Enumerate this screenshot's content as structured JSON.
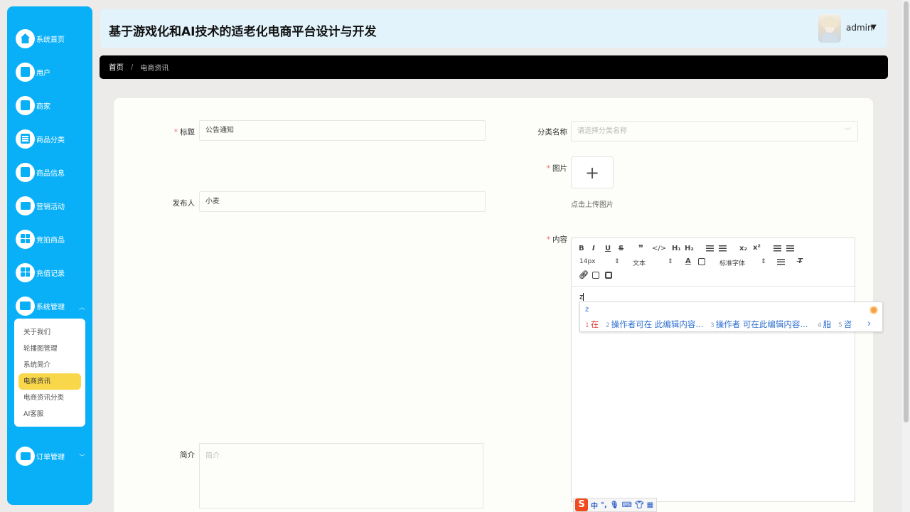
{
  "app_title": "基于游戏化和AI技术的适老化电商平台设计与开发",
  "user": {
    "name": "admin"
  },
  "sidebar": {
    "items": [
      {
        "label": "系统首页",
        "icon": "home-icon"
      },
      {
        "label": "用户",
        "icon": "clipboard-icon"
      },
      {
        "label": "商家",
        "icon": "clipboard-check-icon"
      },
      {
        "label": "商品分类",
        "icon": "list-icon"
      },
      {
        "label": "商品信息",
        "icon": "document-icon"
      },
      {
        "label": "营销活动",
        "icon": "monitor-icon"
      },
      {
        "label": "竞拍商品",
        "icon": "grid-icon"
      },
      {
        "label": "充值记录",
        "icon": "grid-icon"
      },
      {
        "label": "系统管理",
        "icon": "server-icon"
      },
      {
        "label": "订单管理",
        "icon": "monitor-icon"
      }
    ],
    "submenu": [
      "关于我们",
      "轮播图管理",
      "系统简介",
      "电商资讯",
      "电商资讯分类",
      "AI客服"
    ],
    "active_submenu": "电商资讯"
  },
  "breadcrumb": {
    "home": "首页",
    "separator": "/",
    "current": "电商资讯"
  },
  "form": {
    "title_label": "标题",
    "title_value": "公告通知",
    "category_label": "分类名称",
    "category_placeholder": "请选择分类名称",
    "image_label": "图片",
    "upload_tip": "点击上传图片",
    "publisher_label": "发布人",
    "publisher_value": "小麦",
    "content_label": "内容",
    "summary_label": "简介",
    "summary_placeholder": "简介",
    "required_mark": "*"
  },
  "editor": {
    "font_size": "14px",
    "block_format": "文本",
    "font_family": "标准字体",
    "content_text": "z"
  },
  "ime": {
    "input": "z",
    "candidates": [
      {
        "num": "1",
        "text": "在"
      },
      {
        "num": "2",
        "text": "操作者可在  此编辑内容..."
      },
      {
        "num": "3",
        "text": "操作者  可在此编辑内容..."
      },
      {
        "num": "4",
        "text": "脂"
      },
      {
        "num": "5",
        "text": "咨"
      }
    ],
    "next": "›",
    "bar": {
      "logo": "S",
      "mode": "中",
      "punct": "°,"
    }
  },
  "colors": {
    "sidebar": "#0ab0f7",
    "header": "#e2f3fb",
    "active_sub": "#f9d74a",
    "required": "#f56c6c"
  }
}
